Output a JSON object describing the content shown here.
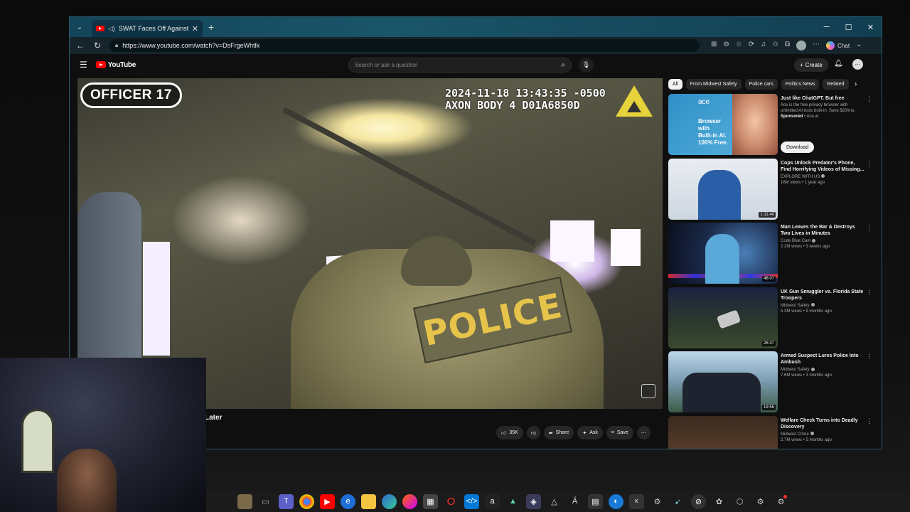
{
  "browser": {
    "tab_title": "SWAT Faces Off Against Killer",
    "url": "https://www.youtube.com/watch?v=DsFrgeWhtlk",
    "chat_label": "Chat"
  },
  "youtube": {
    "logo_text": "YouTube",
    "search_placeholder": "Search or ask a question",
    "create_label": "Create"
  },
  "video": {
    "officer_label": "OFFICER 17",
    "bodycam_stamp": "2024-11-18 13:43:35 -0500\nAXON BODY 4 D01A6850D",
    "patch_text": "POLICE",
    "title_fragment": "Later",
    "like_count": "35K",
    "share_label": "Share",
    "ask_label": "Ask",
    "save_label": "Save"
  },
  "sidebar": {
    "chips": [
      "All",
      "From Midwest Safety",
      "Police cars",
      "Politics News",
      "Related"
    ],
    "ad": {
      "title": "Just like ChatGPT. But free",
      "body": "Ace is the free privacy browser with unlimited AI tools built-in. Save $20/mo.",
      "sponsored": "Sponsored",
      "advertiser": "Ace.ai",
      "logo": "ace",
      "copy": "Browser\nwith\nBuilt-in AI.\n100% Free.",
      "download_label": "Download"
    },
    "recommendations": [
      {
        "title": "Cops Unlock Predator's Phone, Find Horrifying Videos of Missing...",
        "channel": "EXPLORE WITH US",
        "meta": "16M views • 1 year ago",
        "duration": "1:11:40"
      },
      {
        "title": "Man Leaves the Bar & Destroys Two Lives in Minutes",
        "channel": "Code Blue Cam",
        "meta": "2.2M views • 3 weeks ago",
        "duration": "46:07"
      },
      {
        "title": "UK Gun Smuggler vs. Florida State Troopers",
        "channel": "Midwest Safety",
        "meta": "5.3M views • 9 months ago",
        "duration": "26:37"
      },
      {
        "title": "Armed Suspect Lures Police Into Ambush",
        "channel": "Midwest Safety",
        "meta": "7.6M views • 3 months ago",
        "duration": "19:55"
      },
      {
        "title": "Welfare Check Turns into Deadly Discovery",
        "channel": "Midwest Crime",
        "meta": "2.7M views • 5 months ago",
        "duration": ""
      }
    ]
  },
  "taskbar": {
    "icons": [
      "desktop-photo",
      "task-view",
      "teams",
      "chrome",
      "youtube",
      "edge-beta",
      "file-explorer",
      "edge",
      "firefox",
      "store",
      "opera",
      "vscode",
      "amazon",
      "app-a",
      "app-shield",
      "app-triangle",
      "app-ai",
      "app-box",
      "app-blue",
      "app-k",
      "app-gear",
      "app-bird",
      "app-circle",
      "app-settings",
      "app-cube",
      "app-gear2",
      "app-badge"
    ]
  }
}
